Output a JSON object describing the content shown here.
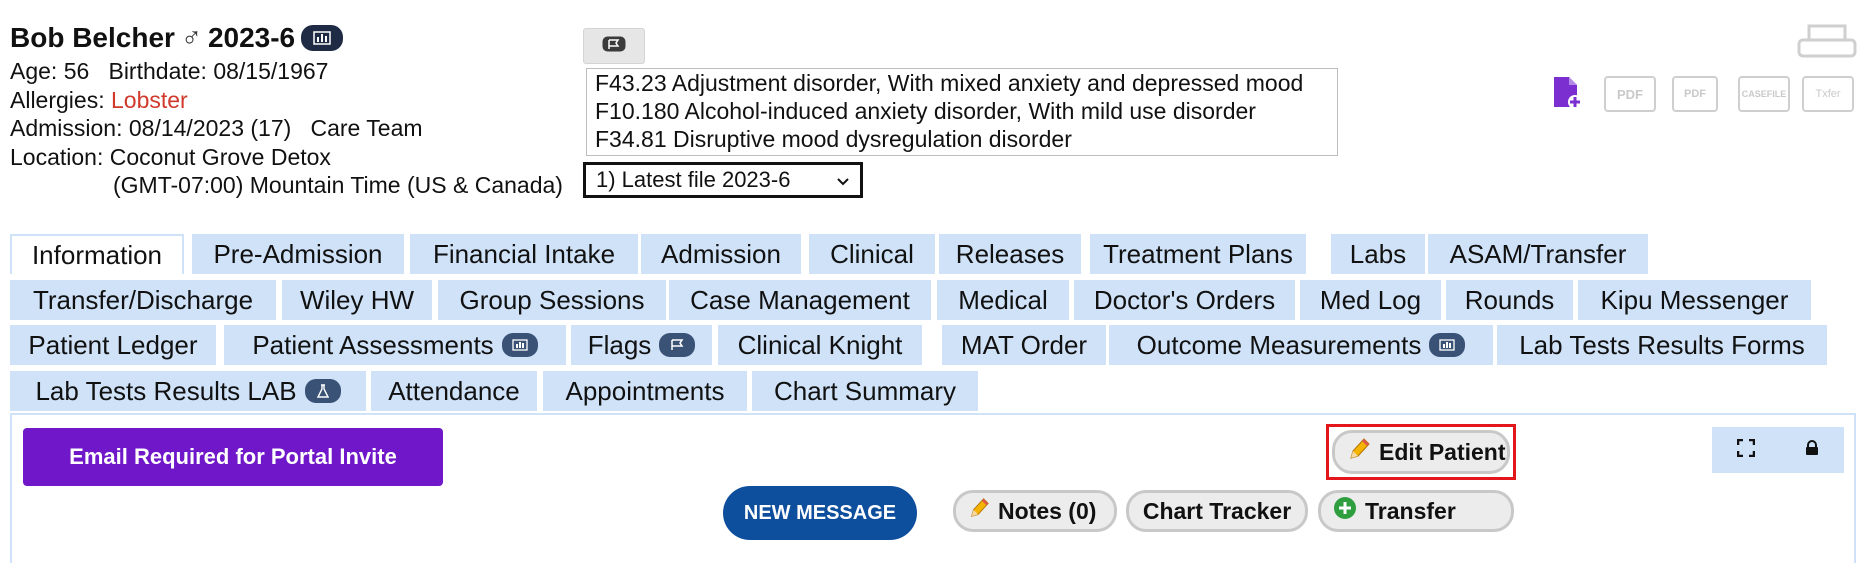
{
  "patient": {
    "name": "Bob Belcher",
    "gender_symbol": "♂",
    "file_id": "2023-6",
    "age_label": "Age:",
    "age": "56",
    "birthdate_label": "Birthdate:",
    "birthdate": "08/15/1967",
    "allergies_label": "Allergies:",
    "allergies": "Lobster",
    "admission_label": "Admission:",
    "admission": "08/14/2023 (17)",
    "care_team": "Care Team",
    "location_label": "Location:",
    "location": "Coconut Grove Detox",
    "timezone": "(GMT-07:00) Mountain Time (US & Canada)"
  },
  "diagnoses": [
    "F43.23 Adjustment disorder, With mixed anxiety and depressed mood",
    "F10.180 Alcohol-induced anxiety disorder, With mild use disorder",
    "F34.81 Disruptive mood dysregulation disorder"
  ],
  "file_select": {
    "value": "1) Latest file 2023-6"
  },
  "doc_icons": {
    "pdf": "PDF",
    "pdf_small": "PDF",
    "casefile": "CASEFILE",
    "txfer": "Txfer"
  },
  "tabs": {
    "row1": [
      "Information",
      "Pre-Admission",
      "Financial Intake",
      "Admission",
      "Clinical",
      "Releases",
      "Treatment Plans",
      "Labs",
      "ASAM/Transfer"
    ],
    "row2": [
      "Transfer/Discharge",
      "Wiley HW",
      "Group Sessions",
      "Case Management",
      "Medical",
      "Doctor's Orders",
      "Med Log",
      "Rounds",
      "Kipu Messenger"
    ],
    "row3": [
      "Patient Ledger",
      "Patient Assessments",
      "Flags",
      "Clinical Knight",
      "MAT Order",
      "Outcome Measurements",
      "Lab Tests Results Forms"
    ],
    "row4": [
      "Lab Tests Results LAB",
      "Attendance",
      "Appointments",
      "Chart Summary"
    ]
  },
  "actions": {
    "portal_invite": "Email Required for Portal Invite",
    "edit_patient": "Edit Patient",
    "new_message": "NEW MESSAGE",
    "notes": "Notes (0)",
    "chart_tracker": "Chart Tracker",
    "transfer": "Transfer"
  },
  "colors": {
    "tab_bg": "#cfe2f8",
    "portal_button": "#6f17c9",
    "new_message": "#0d4f9c",
    "allergy_text": "#d0392b",
    "highlight_border": "#e3161c"
  }
}
